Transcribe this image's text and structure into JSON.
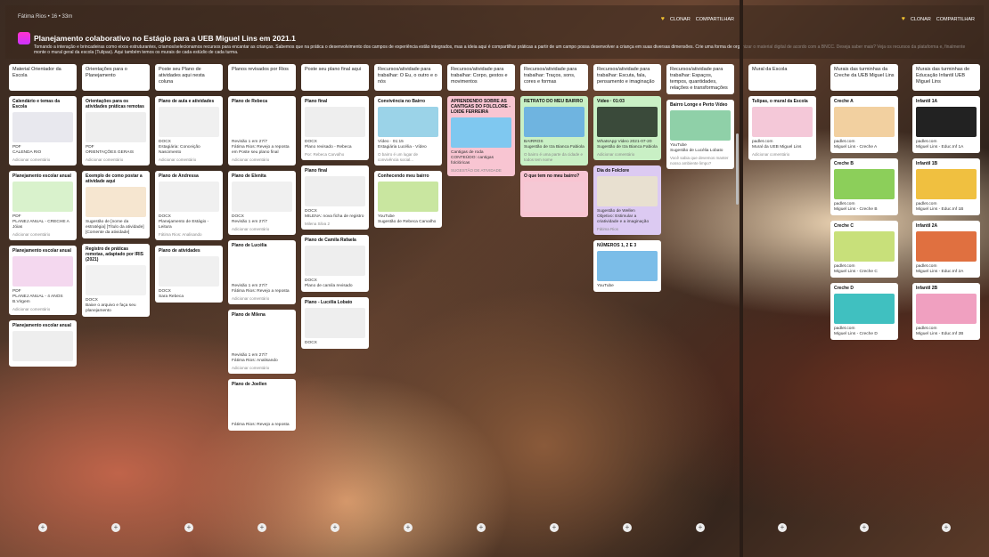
{
  "app": {
    "crumbs": "Fátima Rios • 16 • 33m",
    "title": "Planejamento colaborativo no Estágio para a UEB Miguel Lins em 2021.1",
    "description": "Tomando a interação e brincadeiras como eixos estruturantes, criamos/selecionamos recursos para encantar as crianças. Sabemos que na prática o desenvolvimento dos campos de experiência estão integrados, mas a ideia aqui é compartilhar práticas a partir de um campo possa desenvolver a criança em suas diversas dimensões. Crie uma forma de organizar o material digital de acordo com a BNCC. Deseja saber mais? Veja os recursos da plataforma e, finalmente monte o mural geral da escola (Tulipas). Aqui também temos os murais de cada estúdio de cada turma.",
    "like": "♥",
    "clone": "CLONAR",
    "share": "COMPARTILHAR"
  },
  "columns": [
    {
      "head": "Material Orientador da Escola",
      "cards": [
        {
          "t": "Calendário e temas da Escola",
          "s": "PDF",
          "f": "CALENDA RIO",
          "c": "Adicionar comentário",
          "tc": "#e8e8ee"
        },
        {
          "t": "Planejamento escolar anual",
          "s": "PDF",
          "f": "PLANEJ ANUAL - CRECHE A Jóias",
          "c": "Adicionar comentário",
          "tc": "#d9f2cc"
        },
        {
          "t": "Planejamento escolar anual",
          "s": "PDF",
          "f": "PLANEJ ANUAL - 4 ANOS B.Virgem",
          "c": "Adicionar comentário",
          "tc": "#f4d8ef"
        },
        {
          "t": "Planejamento escolar anual",
          "s": "",
          "f": "",
          "c": "",
          "tc": "#eee"
        }
      ]
    },
    {
      "head": "Orientações para o Planejamento",
      "cards": [
        {
          "t": "Orientações para os atividades práticas remotas",
          "s": "PDF",
          "f": "ORIENTAÇÕES GERAIS",
          "c": "Adicionar comentário",
          "tc": "#eeeeee"
        },
        {
          "t": "Exemplo de como postar a atividade aqui",
          "s": "Sugestão de [nome da estratégia] [Título da atividade]",
          "f": "[Comente da atividade]",
          "c": "",
          "tc": "#f6e6d0"
        },
        {
          "t": "Registro de práticas remotas, adaptado por IRIS (2021)",
          "s": "DOCX",
          "f": "Baixe o arquivo e faça seu planejamento",
          "c": "",
          "tc": "#f2f2f2"
        }
      ]
    },
    {
      "head": "Poste seu Plano de atividades aqui nesta coluna",
      "cards": [
        {
          "t": "Plano de aula e atividades",
          "s": "DOCX",
          "f": "Estagiária: Conceição Nascimento",
          "c": "Adicionar comentário",
          "tc": "#f0f0f0"
        },
        {
          "t": "Plano de Andressa",
          "s": "DOCX",
          "f": "Planejamento de Estágio - Leitura",
          "c": "Fátima Rios: Analisando",
          "tc": "#f0f0f0"
        },
        {
          "t": "Plano de atividades",
          "s": "DOCX",
          "f": "Sara Rebeca",
          "c": "",
          "tc": "#f0f0f0"
        }
      ]
    },
    {
      "head": "Planos revisados por Rios",
      "cards": [
        {
          "t": "Plano de Rebeca",
          "s": "Revisão 1 em 27/7",
          "f": "Fátima Rios: Revejo a reposta em Poste seu plano final",
          "c": "Adicionar comentário",
          "tc": "#fff"
        },
        {
          "t": "Plano de Elenita",
          "s": "DOCX",
          "f": "Revisão 1 em 27/7",
          "c": "Adicionar comentário",
          "tc": "#f0f0f0"
        },
        {
          "t": "Plano de Lucélia",
          "s": "Revisão 1 em 27/7",
          "f": "Fátima Rios: Revejo a reposta",
          "c": "Adicionar comentário",
          "tc": "#fff"
        },
        {
          "t": "Plano de Milena",
          "s": "Revisão 1 em 27/7",
          "f": "Fátima Rios: Analisando",
          "c": "Adicionar comentário",
          "tc": "#fff"
        },
        {
          "t": "Plano de Joellen",
          "s": "Fátima Rios: Revejo a reposta",
          "f": "",
          "c": "",
          "tc": "#fff"
        }
      ]
    },
    {
      "head": "Poste seu plano final aqui",
      "cards": [
        {
          "t": "Plano final",
          "s": "DOCX",
          "f": "Plano revisado - Rebeca",
          "c": "Por: Rebeca Carvalho",
          "tc": "#eeeeee"
        },
        {
          "t": "Plano final",
          "s": "DOCX",
          "f": "MILENA: nova ficha de registro",
          "c": "Milena Silva 2",
          "tc": "#eeeeee"
        },
        {
          "t": "Plano de Camila Rafaela",
          "s": "DOCX",
          "f": "Plano de camila revisado",
          "c": "",
          "tc": "#eeeeee"
        },
        {
          "t": "Plano - Lucélia Lobato",
          "s": "DOCX",
          "f": "",
          "c": "",
          "tc": "#eeeeee"
        }
      ]
    },
    {
      "head": "Recursos/atividade para trabalhar: O Eu, o outro e o nós",
      "cards": [
        {
          "t": "Convivência no Bairro",
          "s": "Vídeo · 01:15",
          "f": "Estagiária Lucélia - Vídeo",
          "c": "O bairro é um lugar de convivência social...",
          "tc": "#9bd3e8"
        },
        {
          "t": "Conhecendo meu bairro",
          "s": "YouTube",
          "f": "Sugestão de Rebeca Carvalho",
          "c": "",
          "tc": "#c9e6a0"
        }
      ]
    },
    {
      "head": "Recursos/atividade para trabalhar: Corpo, gestos e movimentos",
      "cards": [
        {
          "t": "APRENDENDO SOBRE AS CANTIGAS DO FOLCLORE - LOIDE FERREIRA",
          "s": "Cantigas de roda",
          "f": "CONTEÚDO: cantigas folclóricas",
          "c": "SUGESTÃO DE ATIVIDADE",
          "tc": "#7fc8f0",
          "cls": "pink"
        }
      ]
    },
    {
      "head": "Recursos/atividade para trabalhar: Traços, sons, cores e formas",
      "cards": [
        {
          "t": "RETRATO DO MEU BAIRRO",
          "s": "BAIRROS",
          "f": "Sugestão de Iza Bianca Fabiola",
          "c": "O bairro é uma parte da cidade e todos tem nome",
          "tc": "#6fb4e0",
          "cls": "green"
        },
        {
          "t": "O que tem no meu bairro?",
          "s": "",
          "f": "",
          "c": "",
          "tc": "#f5c8d4",
          "cls": "pink"
        }
      ]
    },
    {
      "head": "Recursos/atividade para trabalhar: Escuta, fala, pensamento e imaginação",
      "cards": [
        {
          "t": "Vídeo · 01:03",
          "s": "WhatsApp Video 2021-07-20",
          "f": "Sugestão de Iza Bianca Fabiola",
          "c": "Adicionar comentário",
          "tc": "#3a4a3a",
          "cls": "green"
        },
        {
          "t": "Dia do Folclore",
          "s": "Sugestão de Wellen",
          "f": "Objetivo: Estimular a criatividade e a imaginação",
          "c": "Fátima Rios",
          "tc": "#e8e0d0",
          "cls": "violet"
        },
        {
          "t": "NÚMEROS 1, 2 E 3",
          "s": "YouTube",
          "f": "",
          "c": "",
          "tc": "#7bbde8"
        }
      ]
    },
    {
      "head": "Recursos/atividade para trabalhar: Espaços, tempos, quantidades, relações e transformações",
      "cards": [
        {
          "t": "Bairro Longe e Perto Vídeo",
          "s": "YouTube",
          "f": "Sugestão de Lucélia Lobato",
          "c": "Você sabia que devemos manter nosso ambiente limpo?",
          "tc": "#8fd0a8"
        }
      ]
    }
  ],
  "right": [
    {
      "head": "Mural da Escola",
      "cards": [
        {
          "t": "Tulipas, o mural da Escola",
          "s": "padlet.com",
          "f": "Mural da UEB Miguel Lins",
          "c": "Adicionar comentário",
          "tc": "#f4c8d8"
        }
      ]
    },
    {
      "head": "Murais das turminhas da Creche da UEB Miguel Lins",
      "cards": [
        {
          "t": "Creche A",
          "s": "padlet.com",
          "f": "Miguel Lins - Creche A",
          "c": "",
          "tc": "#f2d0a0"
        },
        {
          "t": "Creche B",
          "s": "padlet.com",
          "f": "Miguel Lins - Creche B",
          "c": "",
          "tc": "#8ccf5a"
        },
        {
          "t": "Creche C",
          "s": "padlet.com",
          "f": "Miguel Lins - Creche C",
          "c": "",
          "tc": "#c8e07a"
        },
        {
          "t": "Creche D",
          "s": "padlet.com",
          "f": "Miguel Lins - Creche D",
          "c": "",
          "tc": "#40c0c0"
        }
      ]
    },
    {
      "head": "Murais das turminhas de Educação Infantil UEB Miguel Lins",
      "cards": [
        {
          "t": "Infantil 1A",
          "s": "padlet.com",
          "f": "Miguel Lins - Educ.Inf 1A",
          "c": "",
          "tc": "#222"
        },
        {
          "t": "Infantil 1B",
          "s": "padlet.com",
          "f": "Miguel Lins - Educ.Inf 1B",
          "c": "",
          "tc": "#f0c040"
        },
        {
          "t": "Infantil 2A",
          "s": "padlet.com",
          "f": "Miguel Lins - Educ.Inf 2A",
          "c": "",
          "tc": "#e07040"
        },
        {
          "t": "Infantil 2B",
          "s": "padlet.com",
          "f": "Miguel Lins - Educ.Inf 2B",
          "c": "",
          "tc": "#f0a0c0"
        }
      ]
    }
  ]
}
